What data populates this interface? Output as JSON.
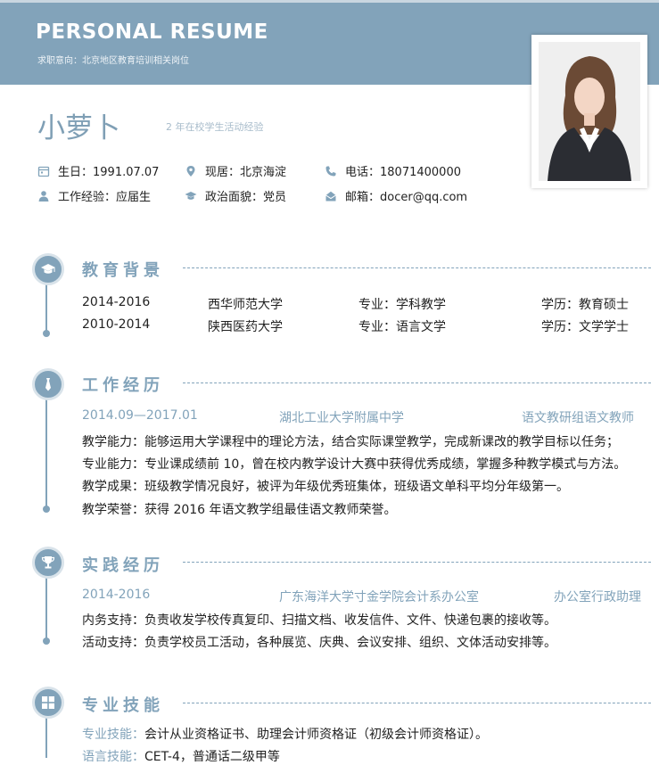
{
  "header": {
    "title": "PERSONAL RESUME",
    "subtitle": "求职意向：北京地区教育培训相关岗位"
  },
  "profile": {
    "name": "小萝卜",
    "tagline": "2 年在校学生活动经验",
    "birth": "生日：1991.07.07",
    "residence": "现居：北京海淀",
    "phone": "电话：18071400000",
    "experience": "工作经验：应届生",
    "politics": "政治面貌：党员",
    "email": "邮箱：docer@qq.com"
  },
  "education": {
    "title": "教育背景",
    "rows": [
      {
        "period": "2014-2016",
        "school": "西华师范大学",
        "major": "专业：学科教学",
        "degree": "学历：教育硕士"
      },
      {
        "period": "2010-2014",
        "school": "陕西医药大学",
        "major": "专业：语言文学",
        "degree": "学历：文学学士"
      }
    ]
  },
  "work": {
    "title": "工作经历",
    "period": "2014.09—2017.01",
    "org": "湖北工业大学附属中学",
    "role": "语文教研组语文教师",
    "lines": [
      "教学能力：能够运用大学课程中的理论方法，结合实际课堂教学，完成新课改的教学目标以任务；",
      "专业能力：专业课成绩前 10，曾在校内教学设计大赛中获得优秀成绩，掌握多种教学模式与方法。",
      "教学成果：班级教学情况良好，被评为年级优秀班集体，班级语文单科平均分年级第一。",
      "教学荣誉：获得 2016 年语文教学组最佳语文教师荣誉。"
    ]
  },
  "practice": {
    "title": "实践经历",
    "period": "2014-2016",
    "org": "广东海洋大学寸金学院会计系办公室",
    "role": "办公室行政助理",
    "lines": [
      "内务支持：负责收发学校传真复印、扫描文档、收发信件、文件、快递包裹的接收等。",
      "活动支持：负责学校员工活动，各种展览、庆典、会议安排、组织、文体活动安排等。"
    ]
  },
  "skills": {
    "title": "专业技能",
    "line1_label": "专业技能：",
    "line1_text": "会计从业资格证书、助理会计师资格证（初级会计师资格证）。",
    "line2_label": "语言技能：",
    "line2_text": "CET-4，普通话二级甲等"
  },
  "colors": {
    "accent": "#82a3ba",
    "header_bg": "#82a3ba"
  }
}
